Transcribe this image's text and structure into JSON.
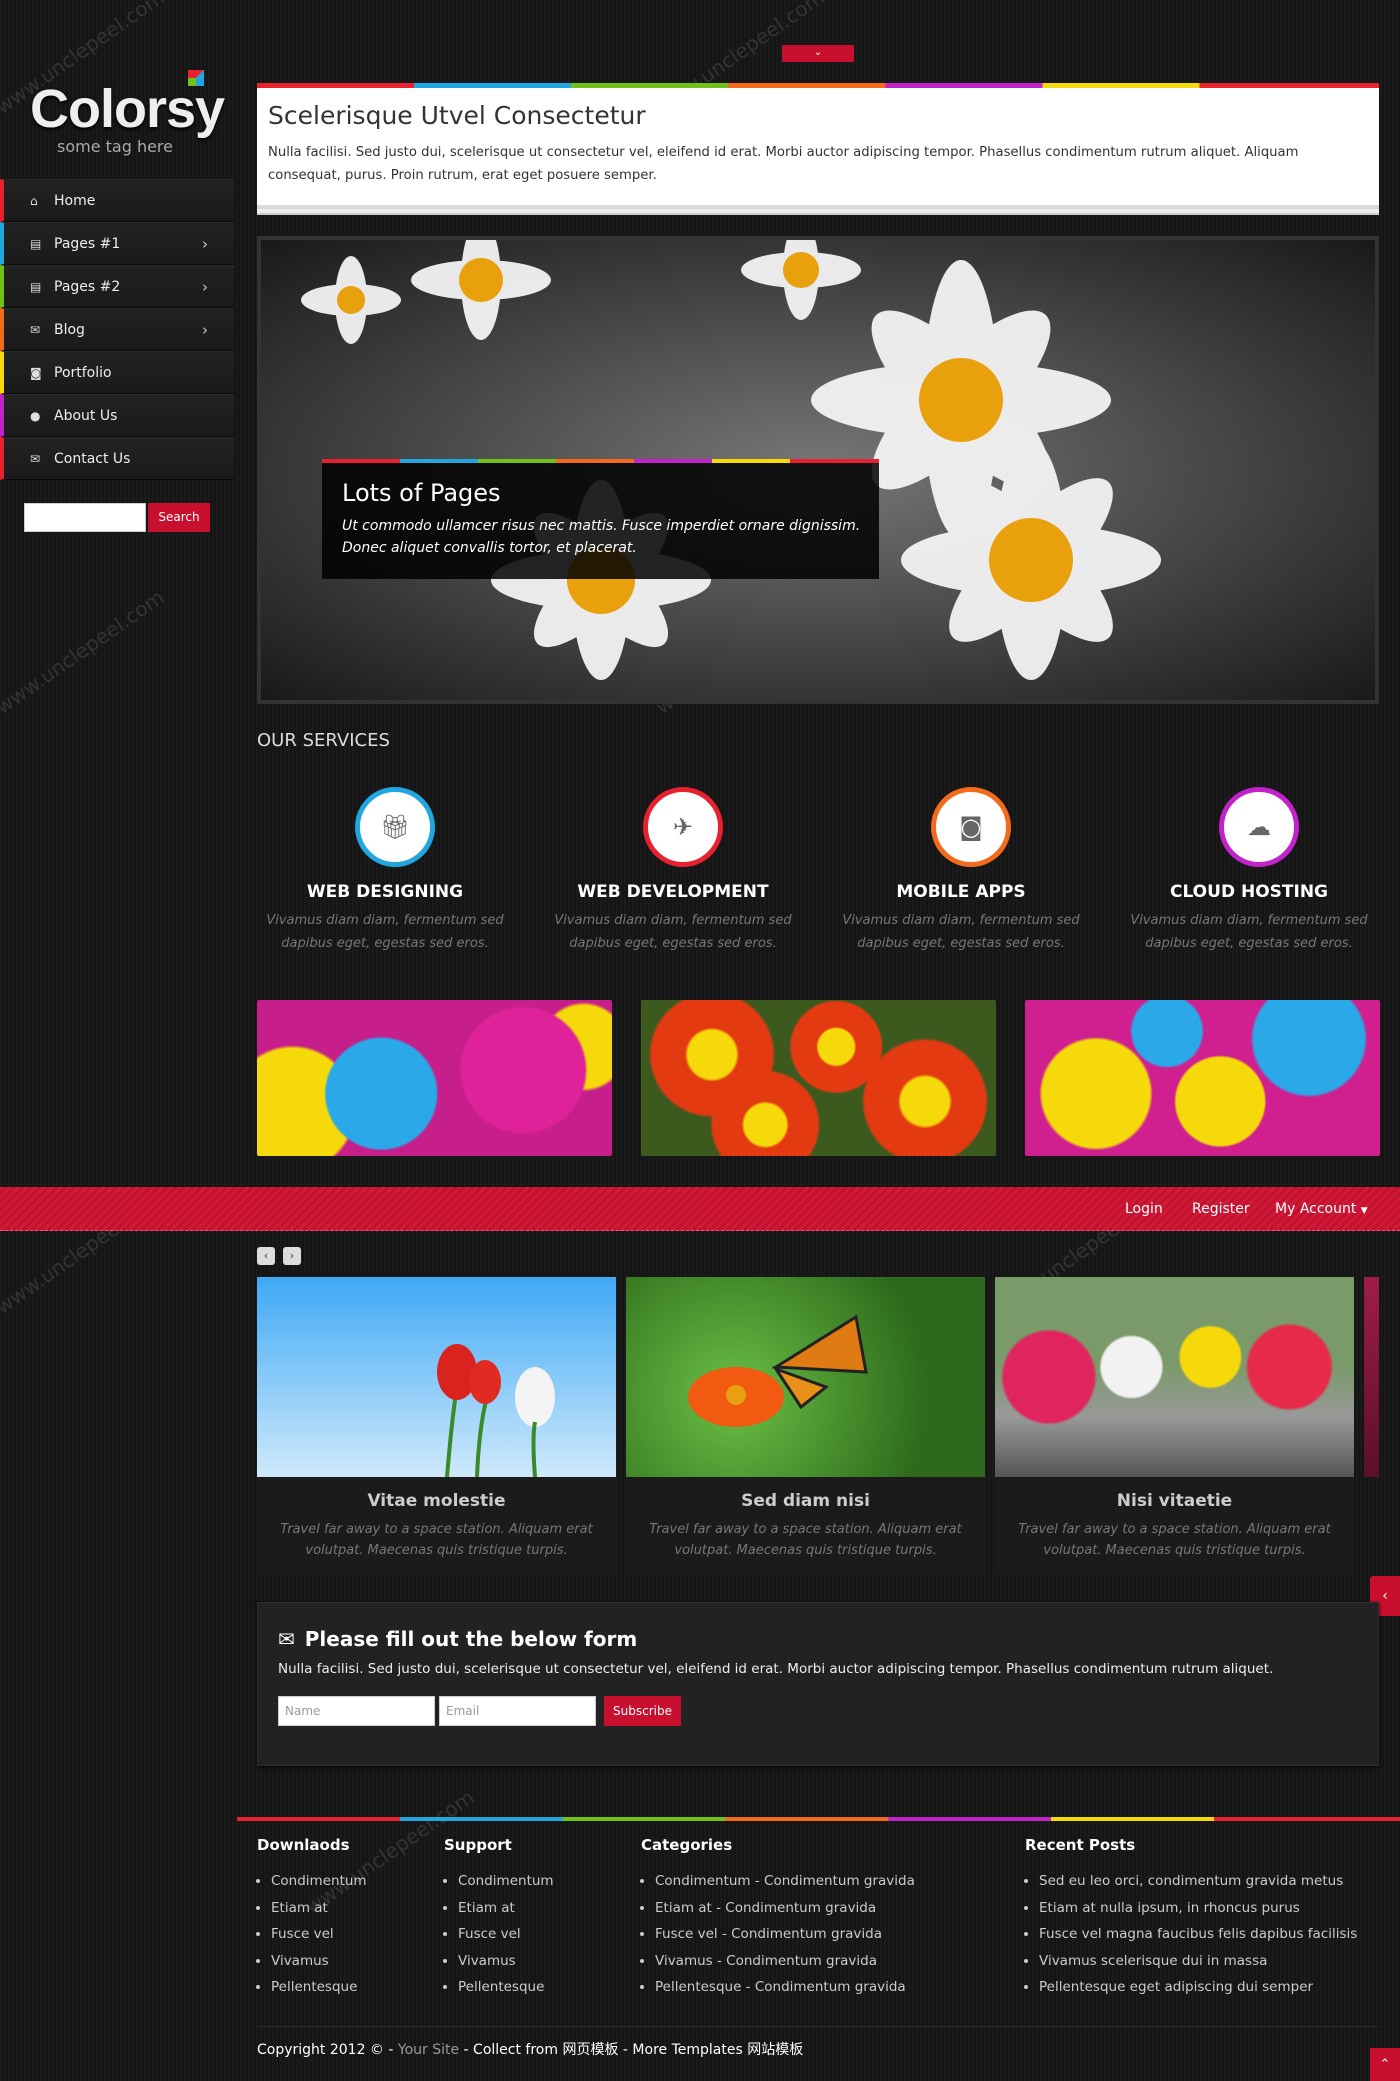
{
  "brand": {
    "name": "Colorsy",
    "tagline": "some tag here"
  },
  "nav": [
    {
      "label": "Home",
      "icon": "home-icon",
      "color": "#e8212e",
      "has_submenu": false
    },
    {
      "label": "Pages #1",
      "icon": "list-icon",
      "color": "#21a6e0",
      "has_submenu": true
    },
    {
      "label": "Pages #2",
      "icon": "list-icon",
      "color": "#70c21a",
      "has_submenu": true
    },
    {
      "label": "Blog",
      "icon": "comments-icon",
      "color": "#f26b1d",
      "has_submenu": true
    },
    {
      "label": "Portfolio",
      "icon": "camera-icon",
      "color": "#f5d90a",
      "has_submenu": false
    },
    {
      "label": "About Us",
      "icon": "user-icon",
      "color": "#c122c9",
      "has_submenu": false
    },
    {
      "label": "Contact Us",
      "icon": "envelope-icon",
      "color": "#e8212e",
      "has_submenu": false
    }
  ],
  "search": {
    "button": "Search",
    "placeholder": ""
  },
  "header": {
    "title": "Scelerisque Utvel Consectetur",
    "text": "Nulla facilisi. Sed justo dui, scelerisque ut consectetur vel, eleifend id erat. Morbi auctor adipiscing tempor. Phasellus condimentum rutrum aliquet. Aliquam consequat, purus. Proin rutrum, erat eget posuere semper."
  },
  "slider": {
    "title": "Lots of Pages",
    "text": "Ut commodo ullamcer risus nec mattis. Fusce imperdiet ornare dignissim. Donec aliquet convallis tortor, et placerat."
  },
  "services": {
    "heading": "OUR SERVICES",
    "items": [
      {
        "title": "WEB DESIGNING",
        "icon": "gift-icon",
        "color": "#21a6e0",
        "text": "Vivamus diam diam, fermentum sed dapibus eget, egestas sed eros."
      },
      {
        "title": "WEB DEVELOPMENT",
        "icon": "plane-icon",
        "color": "#e8212e",
        "text": "Vivamus diam diam, fermentum sed dapibus eget, egestas sed eros."
      },
      {
        "title": "MOBILE APPS",
        "icon": "camera-icon",
        "color": "#f26b1d",
        "text": "Vivamus diam diam, fermentum sed dapibus eget, egestas sed eros."
      },
      {
        "title": "CLOUD HOSTING",
        "icon": "cloud-icon",
        "color": "#c122c9",
        "text": "Vivamus diam diam, fermentum sed dapibus eget, egestas sed eros."
      }
    ]
  },
  "topbar": {
    "login": "Login",
    "register": "Register",
    "account": "My Account"
  },
  "carousel": [
    {
      "title": "Vitae molestie",
      "text": "Travel far away to a space station. Aliquam erat volutpat. Maecenas quis tristique turpis."
    },
    {
      "title": "Sed diam nisi",
      "text": "Travel far away to a space station. Aliquam erat volutpat. Maecenas quis tristique turpis."
    },
    {
      "title": "Nisi vitaetie",
      "text": "Travel far away to a space station. Aliquam erat volutpat. Maecenas quis tristique turpis."
    }
  ],
  "form": {
    "title": "Please fill out the below form",
    "text": "Nulla facilisi. Sed justo dui, scelerisque ut consectetur vel, eleifend id erat. Morbi auctor adipiscing tempor. Phasellus condimentum rutrum aliquet.",
    "name_placeholder": "Name",
    "email_placeholder": "Email",
    "button": "Subscribe"
  },
  "footer": {
    "downloads": {
      "title": "Downlaods",
      "items": [
        "Condimentum",
        "Etiam at",
        "Fusce vel",
        "Vivamus",
        "Pellentesque"
      ]
    },
    "support": {
      "title": "Support",
      "items": [
        "Condimentum",
        "Etiam at",
        "Fusce vel",
        "Vivamus",
        "Pellentesque"
      ]
    },
    "categories": {
      "title": "Categories",
      "items": [
        "Condimentum - Condimentum gravida",
        "Etiam at - Condimentum gravida",
        "Fusce vel - Condimentum gravida",
        "Vivamus - Condimentum gravida",
        "Pellentesque - Condimentum gravida"
      ]
    },
    "recent": {
      "title": "Recent Posts",
      "items": [
        "Sed eu leo orci, condimentum gravida metus",
        "Etiam at nulla ipsum, in rhoncus purus",
        "Fusce vel magna faucibus felis dapibus facilisis",
        "Vivamus scelerisque dui in massa",
        "Pellentesque eget adipiscing dui semper"
      ]
    },
    "copyright": {
      "prefix": "Copyright 2012 © - ",
      "site": "Your Site",
      "collect": " - Collect from ",
      "cn1": "网页模板",
      "more": " - More Templates ",
      "cn2": "网站模板"
    }
  },
  "watermark": "www.unclepeel.com"
}
